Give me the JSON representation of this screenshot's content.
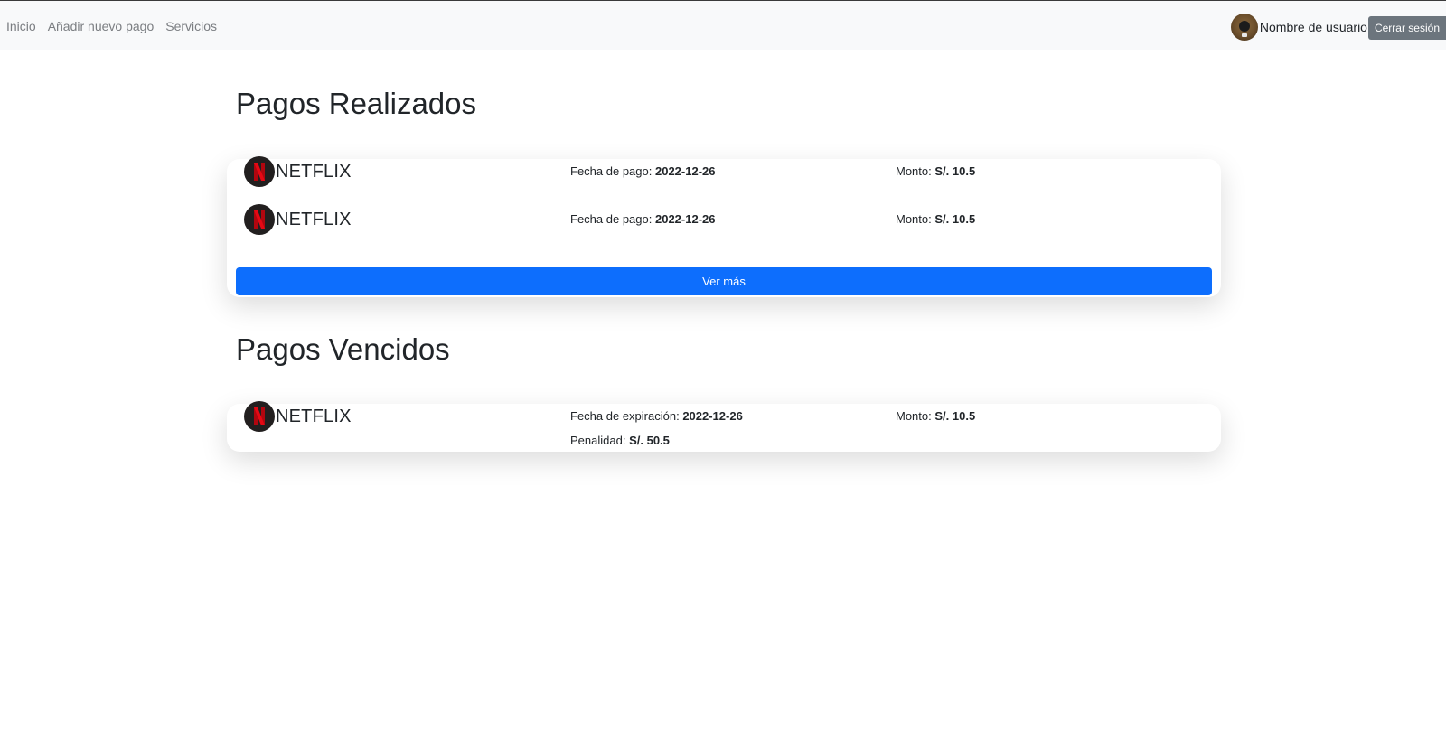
{
  "navbar": {
    "links": [
      "Inicio",
      "Añadir nuevo pago",
      "Servicios"
    ],
    "username": "Nombre de usuario",
    "logout_label": "Cerrar sesión"
  },
  "realizados": {
    "title": "Pagos Realizados",
    "items": [
      {
        "service": "NETFLIX",
        "date_label": "Fecha de pago:",
        "date": "2022-12-26",
        "amount_label": "Monto:",
        "amount": "S/. 10.5"
      },
      {
        "service": "NETFLIX",
        "date_label": "Fecha de pago:",
        "date": "2022-12-26",
        "amount_label": "Monto:",
        "amount": "S/. 10.5"
      }
    ],
    "more_label": "Ver más"
  },
  "vencidos": {
    "title": "Pagos Vencidos",
    "items": [
      {
        "service": "NETFLIX",
        "date_label": "Fecha de expiración:",
        "date": "2022-12-26",
        "amount_label": "Monto:",
        "amount": "S/. 10.5",
        "penalty_label": "Penalidad:",
        "penalty": "S/. 50.5"
      }
    ]
  },
  "colors": {
    "primary": "#0d6efd",
    "secondary": "#6c757d",
    "navbar_bg": "#f8f9fa",
    "netflix_red": "#e50914"
  },
  "icons": {
    "service_logo": "netflix-logo-icon",
    "avatar": "user-avatar-icon"
  }
}
